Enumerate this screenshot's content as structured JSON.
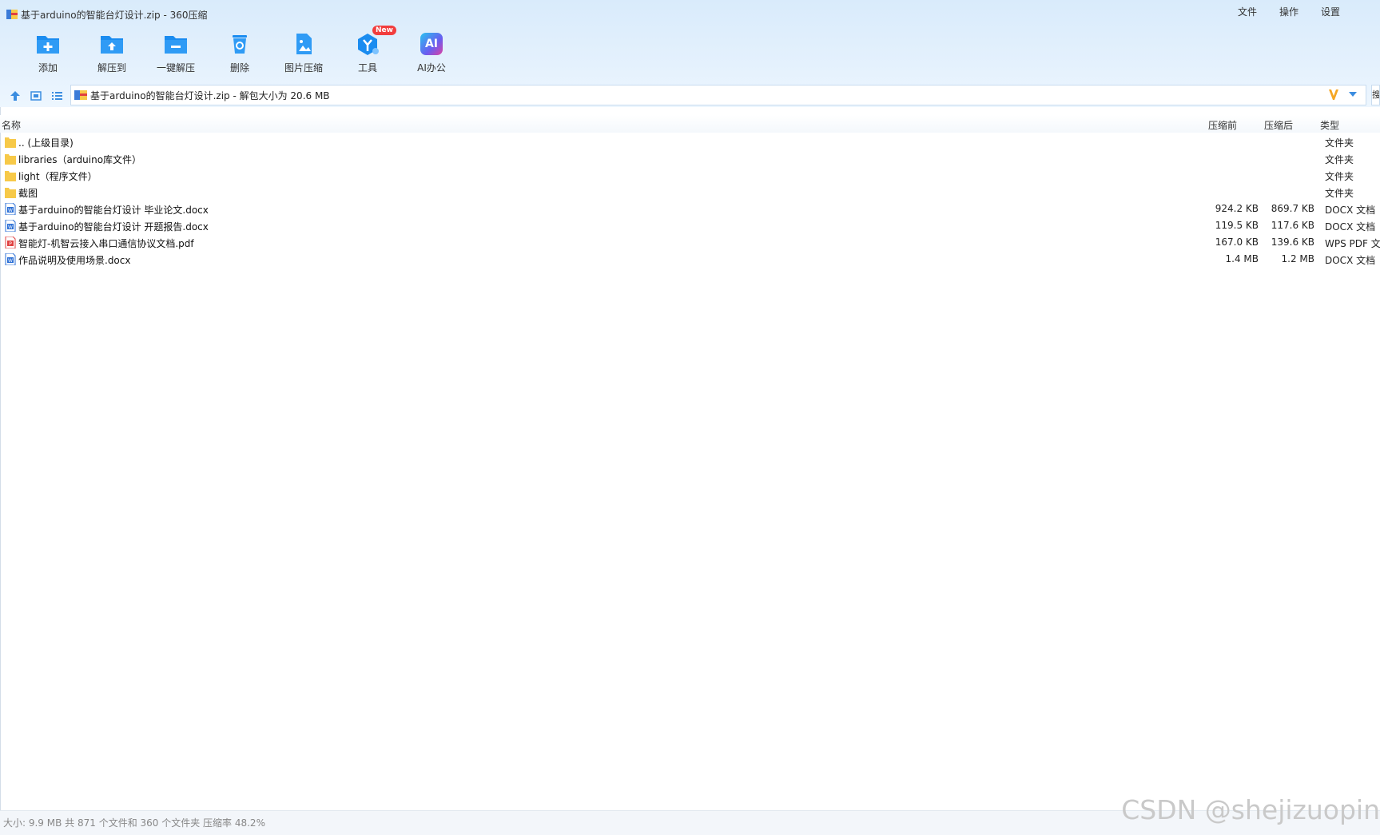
{
  "window": {
    "title": "基于arduino的智能台灯设计.zip - 360压缩",
    "menu": [
      "文件",
      "操作",
      "设置"
    ]
  },
  "toolbar": {
    "add": "添加",
    "extract_to": "解压到",
    "one_click_extract": "一键解压",
    "delete": "删除",
    "image_compress": "图片压缩",
    "tools": "工具",
    "tools_badge": "New",
    "ai_office": "AI办公",
    "ai_icon_text": "AI"
  },
  "address": {
    "path": "基于arduino的智能台灯设计.zip - 解包大小为 20.6 MB",
    "edge_char": "搜"
  },
  "list": {
    "headers": {
      "name": "名称",
      "before": "压缩前",
      "after": "压缩后",
      "type": "类型"
    },
    "rows": [
      {
        "name": ".. (上级目录)",
        "before": "",
        "after": "",
        "type": "文件夹",
        "icon": "folder-icon"
      },
      {
        "name": "libraries（arduino库文件）",
        "before": "",
        "after": "",
        "type": "文件夹",
        "icon": "folder-icon"
      },
      {
        "name": "light（程序文件）",
        "before": "",
        "after": "",
        "type": "文件夹",
        "icon": "folder-icon"
      },
      {
        "name": "截图",
        "before": "",
        "after": "",
        "type": "文件夹",
        "icon": "folder-icon"
      },
      {
        "name": "基于arduino的智能台灯设计 毕业论文.docx",
        "before": "924.2 KB",
        "after": "869.7 KB",
        "type": "DOCX 文档",
        "icon": "word-doc-icon"
      },
      {
        "name": "基于arduino的智能台灯设计 开题报告.docx",
        "before": "119.5 KB",
        "after": "117.6 KB",
        "type": "DOCX 文档",
        "icon": "word-doc-icon"
      },
      {
        "name": "智能灯-机智云接入串口通信协议文档.pdf",
        "before": "167.0 KB",
        "after": "139.6 KB",
        "type": "WPS PDF 文",
        "icon": "pdf-doc-icon"
      },
      {
        "name": "作品说明及使用场景.docx",
        "before": "1.4 MB",
        "after": "1.2 MB",
        "type": "DOCX 文档",
        "icon": "word-doc-icon"
      }
    ]
  },
  "status": "大小: 9.9 MB 共 871 个文件和 360 个文件夹 压缩率 48.2%",
  "watermark": "CSDN @shejizuopin",
  "colors": {
    "accent": "#1a8cf0",
    "folder": "#f7c948",
    "pdf": "#e04040",
    "word": "#2b6fd6"
  }
}
